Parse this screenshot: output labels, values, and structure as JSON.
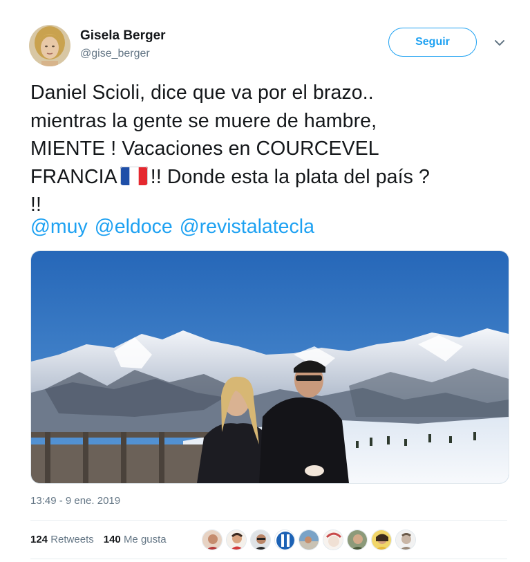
{
  "author": {
    "name": "Gisela Berger",
    "handle": "@gise_berger"
  },
  "follow_button": {
    "label": "Seguir"
  },
  "tweet": {
    "lines": [
      "Daniel Scioli, dice que va por el brazo..",
      "mientras la gente se muere de hambre,",
      "MIENTE ! Vacaciones en COURCEVEL"
    ],
    "line4_before_flag": "FRANCIA",
    "line4_after_flag": "!! Donde esta la plata del país ?",
    "line5": "!!",
    "mentions": [
      "@muy",
      "@eldoce",
      "@revistalatecla"
    ]
  },
  "timestamp": "13:49 - 9 ene. 2019",
  "stats": {
    "retweets_count": "124",
    "retweets_label": "Retweets",
    "likes_count": "140",
    "likes_label": "Me gusta"
  },
  "colors": {
    "accent": "#1da1f2",
    "muted": "#657786",
    "text": "#14171a"
  },
  "icons": {
    "menu": "chevron-down-icon",
    "flag": "france-flag-icon"
  }
}
